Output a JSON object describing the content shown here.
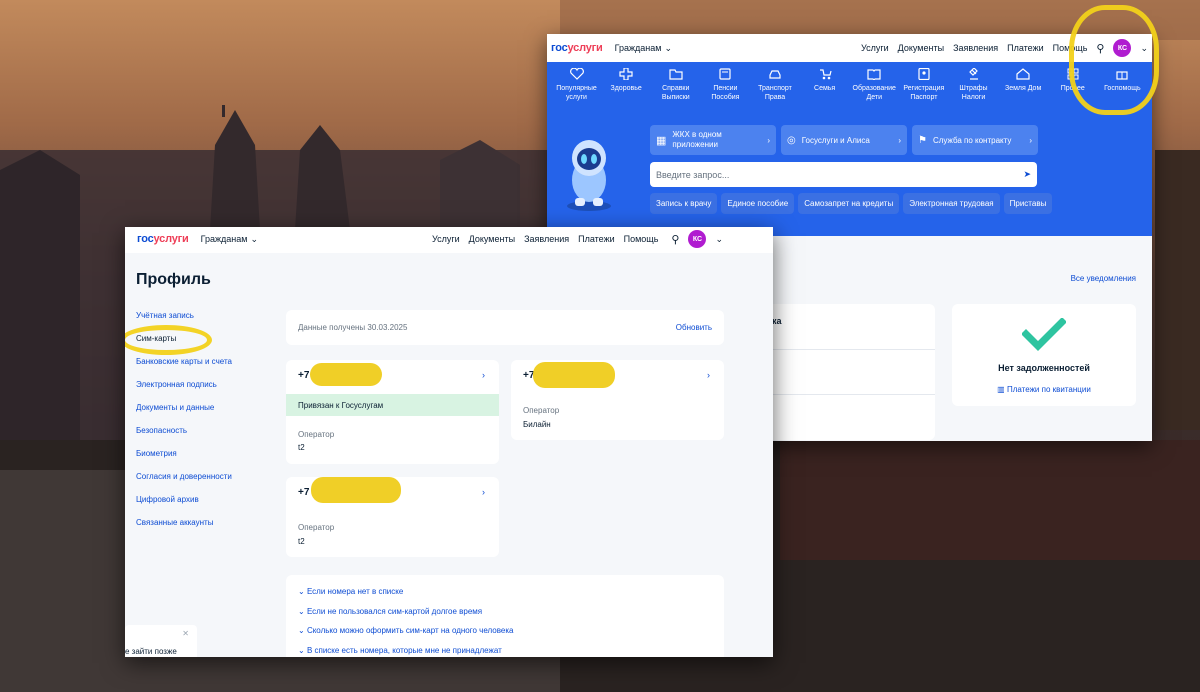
{
  "back": {
    "logo_part1": "гос",
    "logo_part2": "услуги",
    "citizen": "Гражданам",
    "nav": [
      "Услуги",
      "Документы",
      "Заявления",
      "Платежи",
      "Помощь"
    ],
    "avatar": "КС",
    "categories": [
      {
        "label": "Популярные услуги",
        "icon": "heart-icon"
      },
      {
        "label": "Здоровье",
        "icon": "plus-icon"
      },
      {
        "label": "Справки Выписки",
        "icon": "folder-icon"
      },
      {
        "label": "Пенсии Пособия",
        "icon": "wallet-icon"
      },
      {
        "label": "Транспорт Права",
        "icon": "car-icon"
      },
      {
        "label": "Семья",
        "icon": "stroller-icon"
      },
      {
        "label": "Образование Дети",
        "icon": "book-icon"
      },
      {
        "label": "Регистрация Паспорт",
        "icon": "id-card-icon"
      },
      {
        "label": "Штрафы Налоги",
        "icon": "gavel-icon"
      },
      {
        "label": "Земля Дом",
        "icon": "house-icon"
      },
      {
        "label": "Прочее",
        "icon": "grid-icon"
      },
      {
        "label": "Госпомощь",
        "icon": "gift-icon"
      }
    ],
    "tiles": [
      "ЖКХ в одном приложении",
      "Госуслуги и Алиса",
      "Служба по контракту"
    ],
    "search_placeholder": "Введите запрос...",
    "chips": [
      "Запись к врачу",
      "Единое пособие",
      "Самозапрет на кредиты",
      "Электронная трудовая",
      "Приставы"
    ],
    "all_notifications": "Все уведомления",
    "no_debts": "Нет задолженностей",
    "receipt_payments": "Платежи по квитанции",
    "partial_text": "ка"
  },
  "front": {
    "logo_part1": "гос",
    "logo_part2": "услуги",
    "citizen": "Гражданам",
    "nav": [
      "Услуги",
      "Документы",
      "Заявления",
      "Платежи",
      "Помощь"
    ],
    "avatar": "КС",
    "title": "Профиль",
    "menu": [
      "Учётная запись",
      "Сим-карты",
      "Банковские карты и счета",
      "Электронная подпись",
      "Документы и данные",
      "Безопасность",
      "Биометрия",
      "Согласия и доверенности",
      "Цифровой архив",
      "Связанные аккаунты"
    ],
    "received": "Данные получены 30.03.2025",
    "refresh": "Обновить",
    "sims": [
      {
        "number": "+7",
        "linked": "Привязан к Госуслугам",
        "operator_label": "Оператор",
        "operator": "t2"
      },
      {
        "number": "+7",
        "operator_label": "Оператор",
        "operator": "Билайн"
      },
      {
        "number": "+7",
        "operator_label": "Оператор",
        "operator": "t2"
      }
    ],
    "faq": [
      "Если номера нет в списке",
      "Если не пользовался сим-картой долгое время",
      "Сколько можно оформить сим-карт на одного человека",
      "В списке есть номера, которые мне не принадлежат"
    ],
    "toast_text": "е зайти позже"
  },
  "colors": {
    "accent": "#0d4cd3",
    "brand_red": "#ee3f58",
    "blue_panel": "#2563ea",
    "highlight": "#f2d11a",
    "avatar": "#b01cd0",
    "check": "#2ec4a0"
  }
}
